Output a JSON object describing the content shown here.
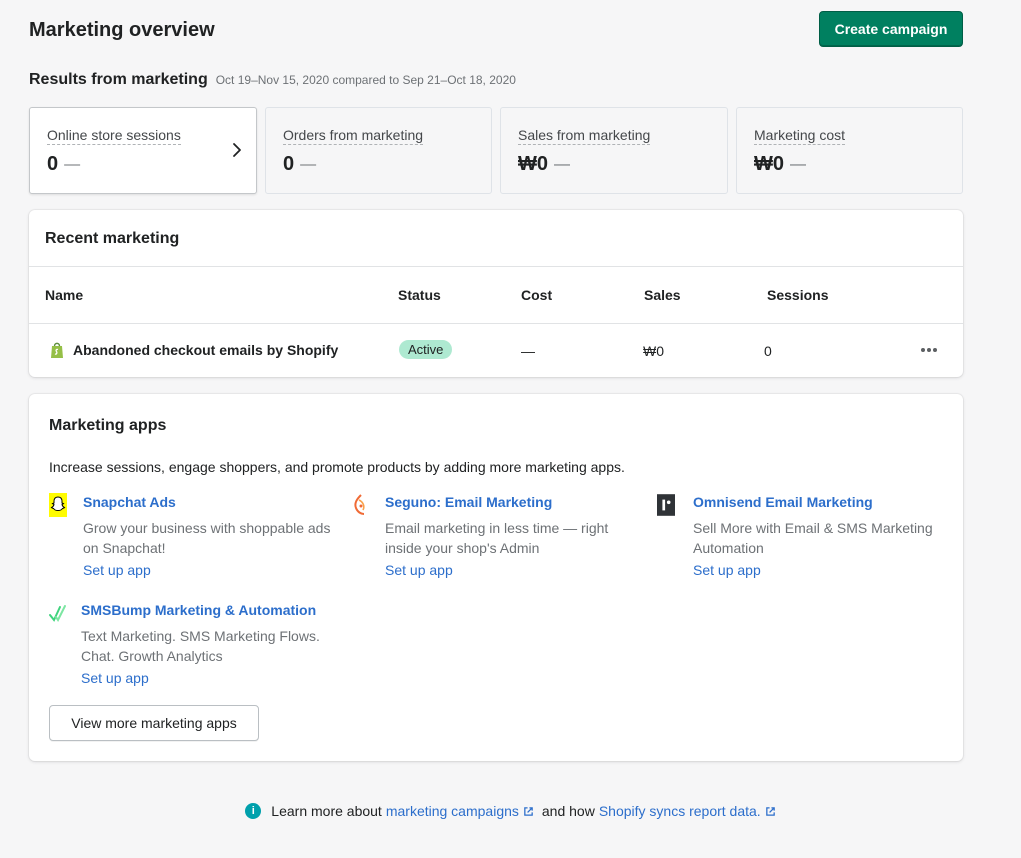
{
  "header": {
    "title": "Marketing overview",
    "create_label": "Create campaign"
  },
  "results": {
    "heading": "Results from marketing",
    "date_range": "Oct 19–Nov 15, 2020 compared to Sep 21–Oct 18, 2020",
    "metrics": [
      {
        "label": "Online store sessions",
        "value": "0",
        "change": "—"
      },
      {
        "label": "Orders from marketing",
        "value": "0",
        "change": "—"
      },
      {
        "label": "Sales from marketing",
        "value": "₩0",
        "change": "—"
      },
      {
        "label": "Marketing cost",
        "value": "₩0",
        "change": "—"
      }
    ]
  },
  "recent": {
    "title": "Recent marketing",
    "columns": [
      "Name",
      "Status",
      "Cost",
      "Sales",
      "Sessions"
    ],
    "rows": [
      {
        "name": "Abandoned checkout emails by Shopify",
        "status": "Active",
        "cost": "—",
        "sales": "₩0",
        "sessions": "0"
      }
    ]
  },
  "apps": {
    "title": "Marketing apps",
    "description": "Increase sessions, engage shoppers, and promote products by adding more marketing apps.",
    "items": [
      {
        "name": "Snapchat Ads",
        "description": "Grow your business with shoppable ads on Snapchat!",
        "action": "Set up app",
        "icon": "snapchat-icon"
      },
      {
        "name": "Seguno: Email Marketing",
        "description": "Email marketing in less time — right inside your shop's Admin",
        "action": "Set up app",
        "icon": "seguno-icon"
      },
      {
        "name": "Omnisend Email Marketing",
        "description": "Sell More with Email & SMS Marketing Automation",
        "action": "Set up app",
        "icon": "omnisend-icon"
      },
      {
        "name": "SMSBump Marketing & Automation",
        "description": "Text Marketing. SMS Marketing Flows. Chat. Growth Analytics",
        "action": "Set up app",
        "icon": "smsbump-icon"
      }
    ],
    "view_more_label": "View more marketing apps"
  },
  "footer": {
    "prefix": "Learn more about",
    "link1": "marketing campaigns",
    "middle": "and how",
    "link2": "Shopify syncs report data."
  },
  "colors": {
    "primary": "#008060",
    "link": "#2c6ecb",
    "badge_success": "#aee9d1",
    "info": "#00a0ac"
  }
}
